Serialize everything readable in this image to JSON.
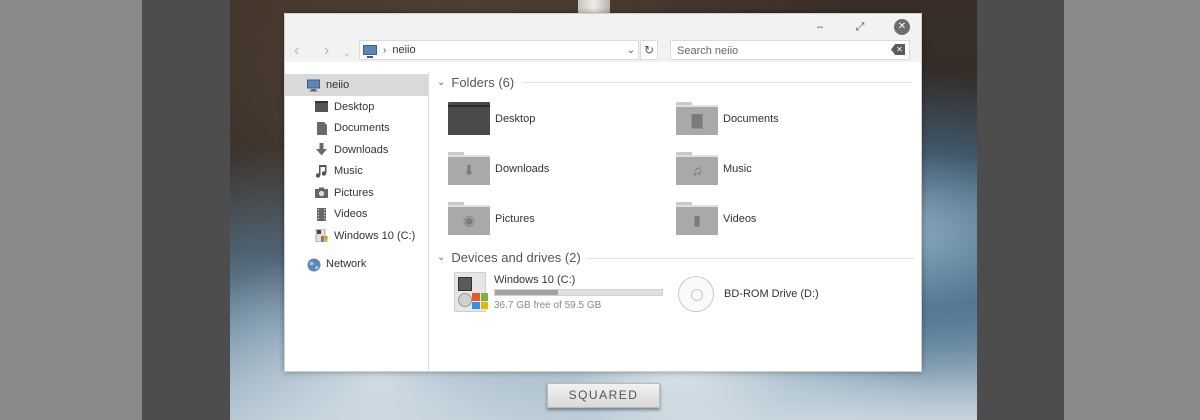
{
  "window": {
    "min_glyph": "–",
    "max_glyph": "⤢",
    "close_glyph": "✕"
  },
  "navbar": {
    "back_glyph": "‹",
    "forward_glyph": "›",
    "recent_glyph": "⌄",
    "breadcrumb_sep": "›",
    "address": "neiio",
    "address_dropdown_glyph": "⌄",
    "refresh_glyph": "↻",
    "search_placeholder": "Search neiio",
    "search_clear_glyph": "✕"
  },
  "sidebar": {
    "root": {
      "label": "neiio",
      "icon": "computer-icon"
    },
    "items": [
      {
        "label": "Desktop",
        "icon": "desktop-icon"
      },
      {
        "label": "Documents",
        "icon": "document-icon"
      },
      {
        "label": "Downloads",
        "icon": "download-arrow-icon"
      },
      {
        "label": "Music",
        "icon": "music-note-icon"
      },
      {
        "label": "Pictures",
        "icon": "camera-icon"
      },
      {
        "label": "Videos",
        "icon": "film-icon"
      },
      {
        "label": "Windows 10 (C:)",
        "icon": "drive-icon"
      }
    ],
    "network": {
      "label": "Network",
      "icon": "globe-icon"
    }
  },
  "folders_group": {
    "chevron": "⌄",
    "title": "Folders (6)",
    "items": [
      {
        "label": "Desktop",
        "glyph": ""
      },
      {
        "label": "Documents",
        "glyph": "▇"
      },
      {
        "label": "Downloads",
        "glyph": "⬇"
      },
      {
        "label": "Music",
        "glyph": "♫"
      },
      {
        "label": "Pictures",
        "glyph": "◉"
      },
      {
        "label": "Videos",
        "glyph": "▮"
      }
    ]
  },
  "drives_group": {
    "chevron": "⌄",
    "title": "Devices and drives (2)",
    "drive_c": {
      "name": "Windows 10 (C:)",
      "free_text": "36.7 GB free of 59.5 GB",
      "used_fraction": 0.38
    },
    "drive_d": {
      "name": "BD-ROM Drive (D:)"
    }
  },
  "theme_label": "SQUARED",
  "colors": {
    "accent_selected": "#d9d9d9",
    "progress_fill": "#a3a3a3",
    "win_logo": [
      "#e25b2c",
      "#7cb342",
      "#3a8ee6",
      "#f0b400"
    ]
  }
}
